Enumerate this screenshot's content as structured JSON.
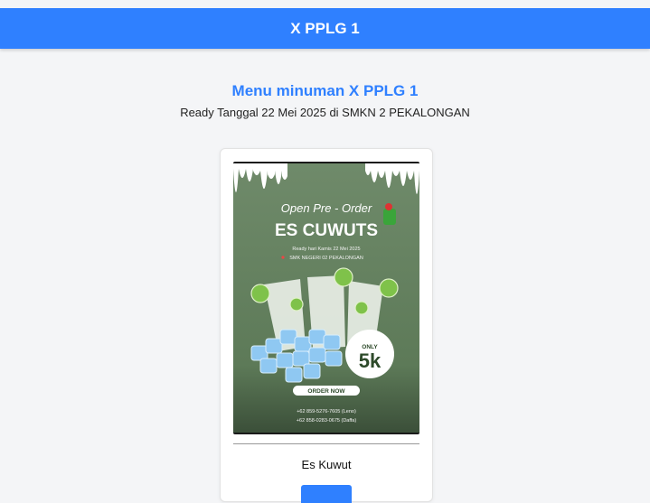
{
  "navbar": {
    "title": "X PPLG 1"
  },
  "main": {
    "heading": "Menu minuman X PPLG 1",
    "subheading": "Ready Tanggal 22 Mei 2025 di SMKN 2 PEKALONGAN"
  },
  "product": {
    "name": "Es Kuwut",
    "button_label": "",
    "poster": {
      "kicker": "Open Pre - Order",
      "title": "ES CUWUTS",
      "ready_line": "Ready hari Kamis 22 Mei 2025",
      "location_line": "SMK NEGERI 02 PEKALONGAN",
      "badge_top": "ONLY",
      "badge_price": "5k",
      "cta": "ORDER NOW",
      "contact_1": "+62 859-5276-7605 (Leno)",
      "contact_2": "+62 858-0283-0675 (Daffa)"
    }
  },
  "colors": {
    "primary": "#2f80ff",
    "poster_green": "#6f8a6a",
    "poster_dark_green": "#4f6a4c",
    "background": "#f4f5f7"
  }
}
